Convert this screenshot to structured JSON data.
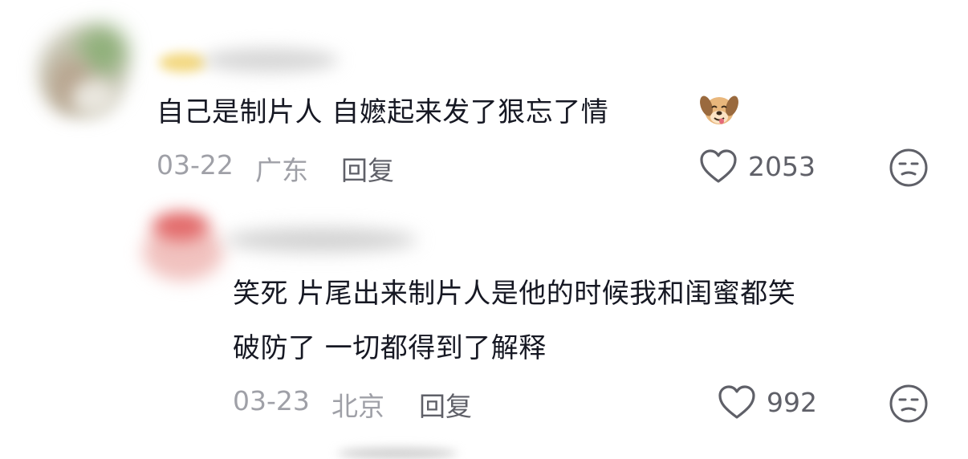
{
  "comments": [
    {
      "text": "自己是制片人 自嬷起来发了狠忘了情",
      "emoji": "dog-face-emoji",
      "date": "03-22",
      "location": "广东",
      "reply_label": "回复",
      "likes": "2053"
    },
    {
      "lines": [
        "笑死 片尾出来制片人是他的时候我和闺蜜都笑",
        "破防了 一切都得到了解释"
      ],
      "date": "03-23",
      "location": "北京",
      "reply_label": "回复",
      "likes": "992"
    }
  ],
  "colors": {
    "text": "#161823",
    "meta": "#9fa0a7",
    "action": "#5f6068"
  },
  "icons": [
    "heart-icon",
    "dislike-face-icon"
  ]
}
